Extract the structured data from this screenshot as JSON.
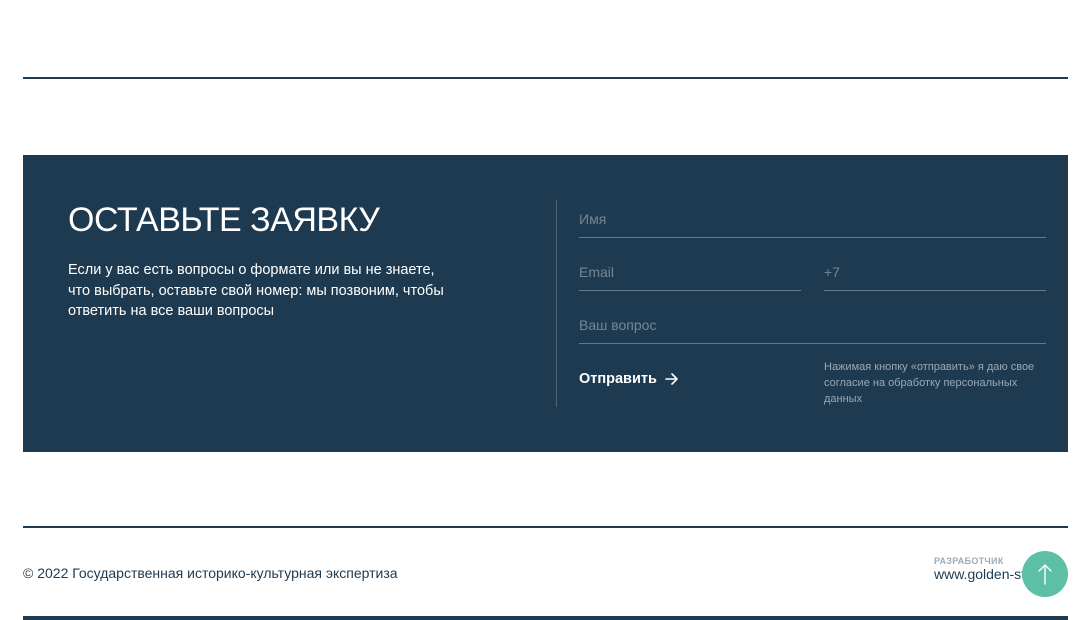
{
  "form": {
    "title": "ОСТАВЬТЕ ЗАЯВКУ",
    "description": "Если у вас есть вопросы о формате или вы не знаете, что выбрать, оставьте свой номер: мы позвоним, чтобы ответить на все ваши вопросы",
    "name_placeholder": "Имя",
    "email_placeholder": "Email",
    "phone_placeholder": "+7",
    "question_placeholder": "Ваш вопрос",
    "submit_label": "Отправить",
    "consent_text": "Нажимая кнопку «отправить» я даю свое согласие на обработку персональных данных"
  },
  "footer": {
    "copyright": "© 2022 Государственная историко-культурная экспертиза",
    "developer_label": "РАЗРАБОТЧИК",
    "developer_link": "www.golden-st"
  },
  "icons": {
    "submit": "arrow-right-icon",
    "scroll_top": "arrow-up-icon"
  },
  "colors": {
    "primary": "#1e3a50",
    "accent": "#5cbfa6",
    "text_on_dark": "#ffffff"
  }
}
